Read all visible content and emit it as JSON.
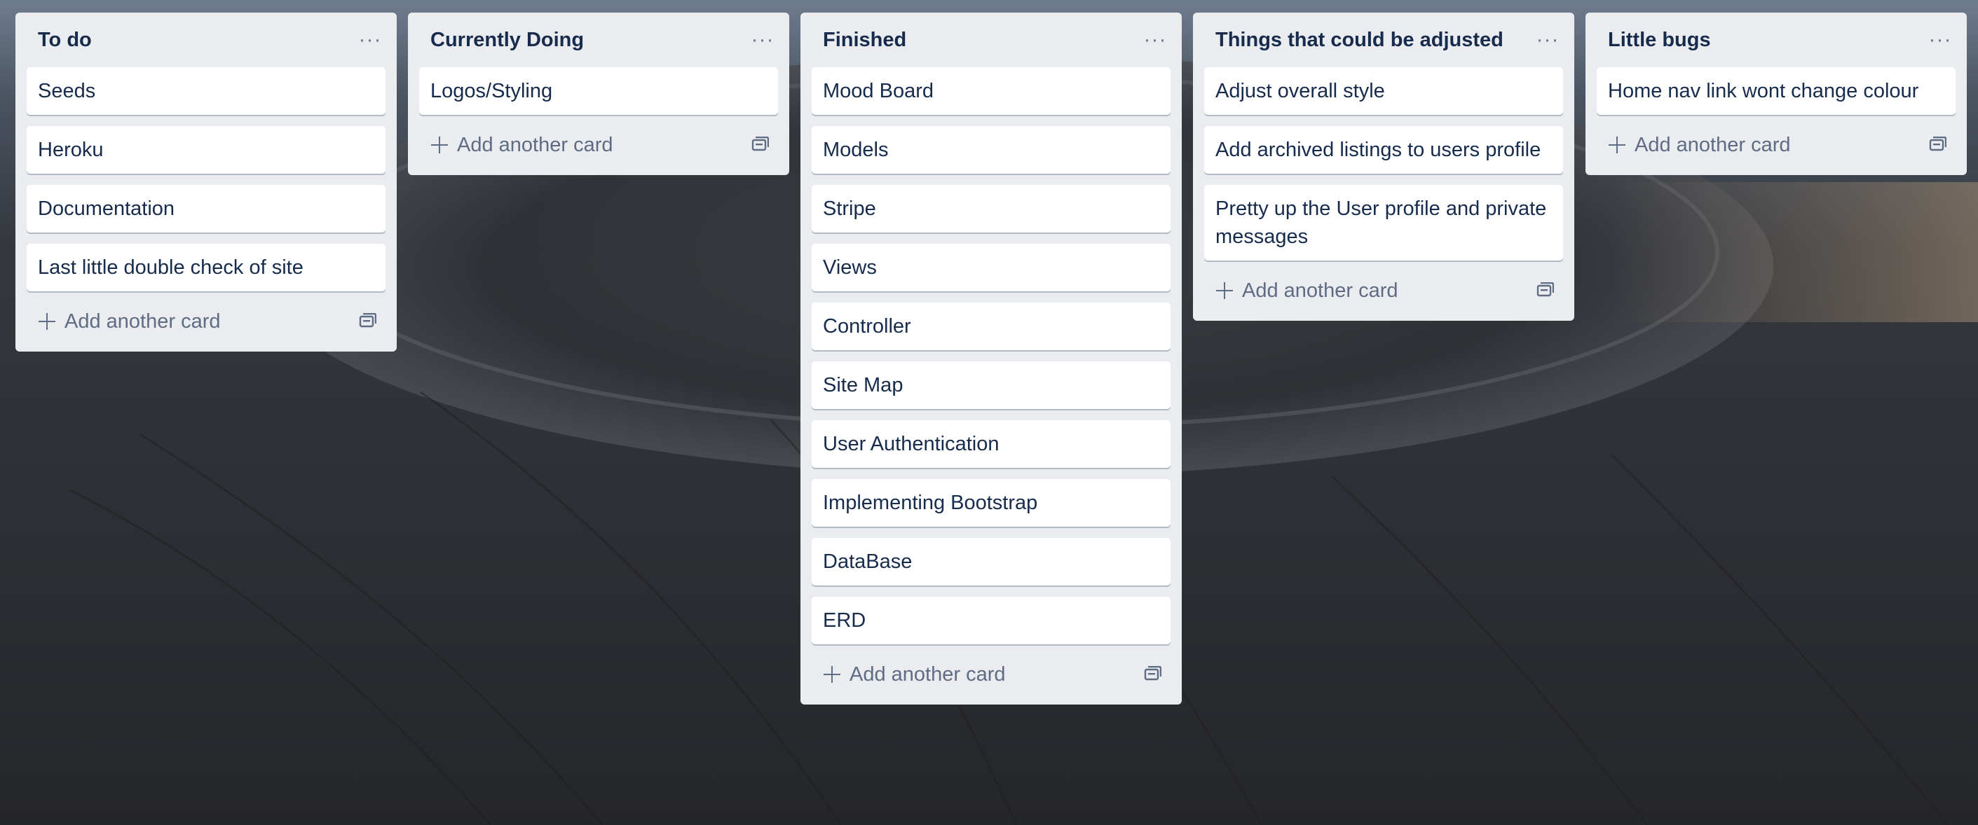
{
  "colors": {
    "list_bg": "#ebecf0",
    "card_bg": "#ffffff",
    "title_text": "#172b4d",
    "muted_text": "#5e6c84"
  },
  "icons": {
    "list_menu": "more-horizontal-icon",
    "add": "plus-icon",
    "template": "card-template-icon"
  },
  "lists": [
    {
      "title": "To do",
      "menu": "···",
      "cards": [
        "Seeds",
        "Heroku",
        "Documentation",
        "Last little double check of site"
      ],
      "add_label": "Add another card"
    },
    {
      "title": "Currently Doing",
      "menu": "···",
      "cards": [
        "Logos/Styling"
      ],
      "add_label": "Add another card"
    },
    {
      "title": "Finished",
      "menu": "···",
      "cards": [
        "Mood Board",
        "Models",
        "Stripe",
        "Views",
        "Controller",
        "Site Map",
        "User Authentication",
        "Implementing Bootstrap",
        "DataBase",
        "ERD"
      ],
      "add_label": "Add another card"
    },
    {
      "title": "Things that could be adjusted",
      "menu": "···",
      "cards": [
        "Adjust overall style",
        "Add archived listings to users profile",
        "Pretty up the User profile and private messages"
      ],
      "add_label": "Add another card"
    },
    {
      "title": "Little bugs",
      "menu": "···",
      "cards": [
        "Home nav link wont change colour"
      ],
      "add_label": "Add another card"
    }
  ]
}
